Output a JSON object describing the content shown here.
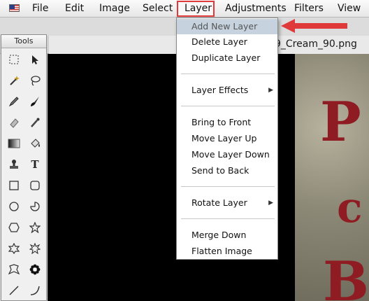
{
  "menubar": {
    "items": [
      "File",
      "Edit",
      "Image",
      "Select",
      "Layer",
      "Adjustments",
      "Filters",
      "View"
    ]
  },
  "document": {
    "tab_title": "9_Cream_90.png"
  },
  "tools_panel": {
    "title": "Tools",
    "tools": [
      {
        "icon": "rectangle-select-icon"
      },
      {
        "icon": "move-arrow-icon"
      },
      {
        "icon": "magic-wand-icon"
      },
      {
        "icon": "lasso-icon"
      },
      {
        "icon": "pencil-icon"
      },
      {
        "icon": "brush-icon"
      },
      {
        "icon": "eraser-icon"
      },
      {
        "icon": "color-picker-icon"
      },
      {
        "icon": "gradient-icon"
      },
      {
        "icon": "paint-bucket-icon"
      },
      {
        "icon": "clone-stamp-icon"
      },
      {
        "icon": "text-icon",
        "label": "T"
      },
      {
        "icon": "rectangle-icon"
      },
      {
        "icon": "rounded-rectangle-icon"
      },
      {
        "icon": "ellipse-icon"
      },
      {
        "icon": "pie-icon"
      },
      {
        "icon": "hexagon-icon"
      },
      {
        "icon": "star-icon"
      },
      {
        "icon": "six-point-star-icon"
      },
      {
        "icon": "burst-icon"
      },
      {
        "icon": "ribbon-star-icon"
      },
      {
        "icon": "flower-icon"
      },
      {
        "icon": "line-icon"
      },
      {
        "icon": "curve-icon"
      }
    ]
  },
  "layer_menu": {
    "items": [
      "Add New Layer",
      "Delete Layer",
      "Duplicate Layer",
      "Layer Effects",
      "Bring to Front",
      "Move Layer Up",
      "Move Layer Down",
      "Send to Back",
      "Rotate Layer",
      "Merge Down",
      "Flatten Image"
    ],
    "highlighted": "Add New Layer"
  },
  "colors": {
    "highlight": "#c6d3de",
    "annotation_red": "#e0393a"
  }
}
